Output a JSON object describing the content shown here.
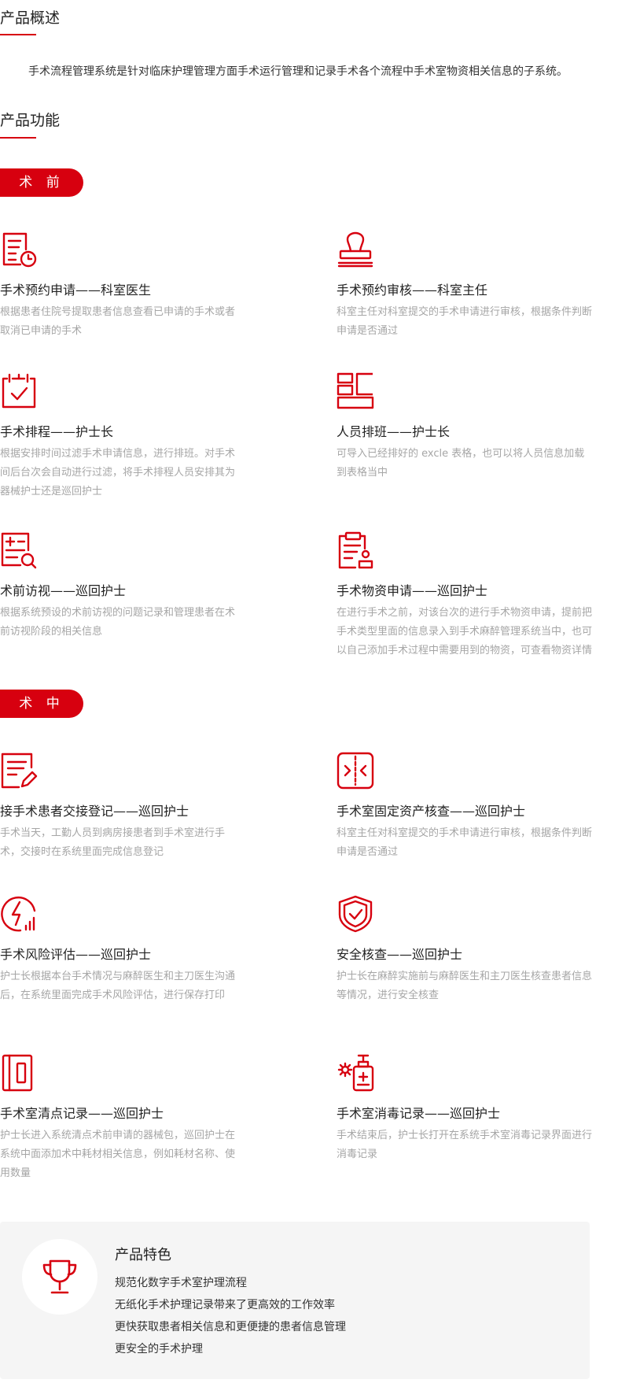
{
  "overview": {
    "title": "产品概述",
    "text": "手术流程管理系统是针对临床护理管理方面手术运行管理和记录手术各个流程中手术室物资相关信息的子系统。"
  },
  "functions": {
    "title": "产品功能"
  },
  "preop": {
    "label": "术 前",
    "items": [
      {
        "icon": "document-clock-icon",
        "title": "手术预约申请——科室医生",
        "lines": [
          "根据患者住院号提取患者信息查看已申请的手术或者",
          "取消已申请的手术"
        ]
      },
      {
        "icon": "stamp-icon",
        "title": "手术预约审核——科室主任",
        "lines": [
          "科室主任对科室提交的手术申请进行审核，根据条件判断",
          "申请是否通过"
        ]
      },
      {
        "icon": "calendar-check-icon",
        "title": "手术排程——护士长",
        "lines": [
          "根据安排时间过滤手术申请信息，进行排班。对手术",
          "间后台次会自动进行过滤，将手术排程人员安排其为",
          "器械护士还是巡回护士"
        ]
      },
      {
        "icon": "layout-grid-icon",
        "title": "人员排班——护士长",
        "lines": [
          "可导入已经排好的 excle 表格，也可以将人员信息加载",
          "到表格当中"
        ]
      },
      {
        "icon": "document-search-icon",
        "title": "术前访视——巡回护士",
        "lines": [
          "根据系统预设的术前访视的问题记录和管理患者在术",
          "前访视阶段的相关信息"
        ]
      },
      {
        "icon": "clipboard-person-icon",
        "title": "手术物资申请——巡回护士",
        "lines": [
          "在进行手术之前，对该台次的进行手术物资申请，提前把",
          "手术类型里面的信息录入到手术麻醉管理系统当中，也可",
          "以自己添加手术过程中需要用到的物资，可查看物资详情"
        ]
      }
    ]
  },
  "intraop": {
    "label": "术 中",
    "items": [
      {
        "icon": "document-edit-icon",
        "title": "接手术患者交接登记——巡回护士",
        "lines": [
          "手术当天，工勤人员到病房接患者到手术室进行手",
          "术，交接时在系统里面完成信息登记"
        ]
      },
      {
        "icon": "split-arrows-icon",
        "title": "手术室固定资产核查——巡回护士",
        "lines": [
          "科室主任对科室提交的手术申请进行审核，根据条件判断",
          "申请是否通过"
        ]
      },
      {
        "icon": "lightning-chart-icon",
        "title": "手术风险评估——巡回护士",
        "lines": [
          "护士长根据本台手术情况与麻醉医生和主刀医生沟通",
          "后，在系统里面完成手术风险评估，进行保存打印"
        ]
      },
      {
        "icon": "shield-check-icon",
        "title": "安全核查——巡回护士",
        "lines": [
          "护士长在麻醉实施前与麻醉医生和主刀医生核查患者信息",
          "等情况，进行安全核查"
        ]
      },
      {
        "icon": "book-icon",
        "title": "手术室清点记录——巡回护士",
        "lines": [
          "护士长进入系统清点术前申请的器械包，巡回护士在",
          "系统中面添加术中耗材相关信息，例如耗材名称、使",
          "用数量"
        ]
      },
      {
        "icon": "sanitizer-icon",
        "title": "手术室消毒记录——巡回护士",
        "lines": [
          "手术结束后，护士长打开在系统手术室消毒记录界面进行",
          "消毒记录"
        ]
      }
    ]
  },
  "highlights": {
    "icon": "trophy-icon",
    "title": "产品特色",
    "items": [
      "规范化数字手术室护理流程",
      "无纸化手术护理记录带来了更高效的工作效率",
      "更快获取患者相关信息和更便捷的患者信息管理",
      "更安全的手术护理"
    ]
  },
  "colors": {
    "accent": "#d7000f",
    "muted_text": "#a6a6a6",
    "panel": "#f5f5f5"
  }
}
